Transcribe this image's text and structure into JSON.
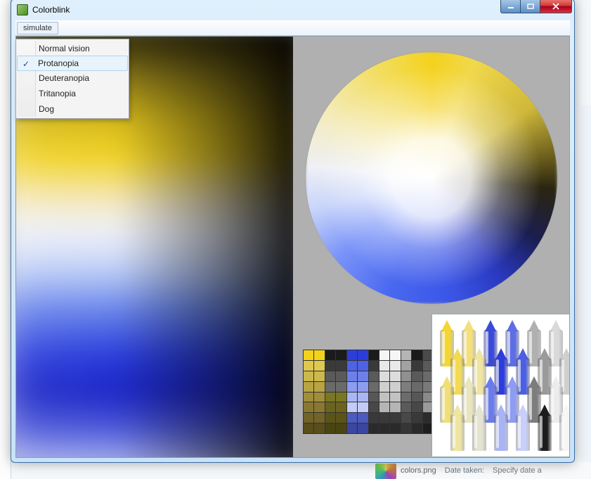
{
  "window": {
    "title": "Colorblink"
  },
  "menu": {
    "simulate_label": "simulate",
    "items": [
      "Normal vision",
      "Protanopia",
      "Deuteranopia",
      "Tritanopia",
      "Dog"
    ],
    "selected_index": 1
  },
  "palette_colors": [
    "#f2d21a",
    "#f2d21a",
    "#1b1b1b",
    "#1b1b1b",
    "#2b3edc",
    "#2b3edc",
    "#1b1b1b",
    "#f6f6f6",
    "#f6f6f6",
    "#b5b5b5",
    "#1b1b1b",
    "#4a4a4a",
    "#dec84f",
    "#dec84f",
    "#3a3a3a",
    "#3a3a3a",
    "#4d62e4",
    "#4d62e4",
    "#3a3a3a",
    "#e9e9e9",
    "#e9e9e9",
    "#a2a2a2",
    "#3a3a3a",
    "#5a5a5a",
    "#cdb84d",
    "#cdb84d",
    "#5a5a5a",
    "#5a5a5a",
    "#6d80ea",
    "#6d80ea",
    "#5a5a5a",
    "#dcdcdc",
    "#dcdcdc",
    "#909090",
    "#5a5a5a",
    "#6a6a6a",
    "#b9a444",
    "#b9a444",
    "#6a6a6a",
    "#6a6a6a",
    "#8c9cf0",
    "#8c9cf0",
    "#6a6a6a",
    "#cfcfcf",
    "#cfcfcf",
    "#7e7e7e",
    "#6a6a6a",
    "#7a7a7a",
    "#a18e3a",
    "#a18e3a",
    "#7a7624",
    "#7a7624",
    "#a9b6f5",
    "#a9b6f5",
    "#575757",
    "#c2c2c2",
    "#c2c2c2",
    "#6c6c6c",
    "#575757",
    "#8a8a8a",
    "#8a7830",
    "#8a7830",
    "#6a641e",
    "#6a641e",
    "#c3ccf8",
    "#c3ccf8",
    "#484848",
    "#b5b5b5",
    "#b5b5b5",
    "#5a5a5a",
    "#484848",
    "#9a9a9a",
    "#726326",
    "#726326",
    "#5a5418",
    "#5a5418",
    "#4c5bc0",
    "#4c5bc0",
    "#393939",
    "#3a3a3a",
    "#3a3a3a",
    "#484848",
    "#393939",
    "#2c2c2c",
    "#5a4d1c",
    "#5a4d1c",
    "#4a4412",
    "#4a4412",
    "#3a46a0",
    "#3a46a0",
    "#2a2a2a",
    "#2a2a2a",
    "#2a2a2a",
    "#363636",
    "#2a2a2a",
    "#1e1e1e"
  ],
  "crayons": [
    {
      "row": 0,
      "col": 0,
      "c": "#f4d632"
    },
    {
      "row": 0,
      "col": 1,
      "c": "#f4e07a"
    },
    {
      "row": 0,
      "col": 2,
      "c": "#3a4bd8"
    },
    {
      "row": 0,
      "col": 3,
      "c": "#5d6de6"
    },
    {
      "row": 0,
      "col": 4,
      "c": "#b0b0b0"
    },
    {
      "row": 0,
      "col": 5,
      "c": "#d9d9d9"
    },
    {
      "row": 1,
      "col": 0,
      "c": "#f2da54"
    },
    {
      "row": 1,
      "col": 1,
      "c": "#efe4a0"
    },
    {
      "row": 1,
      "col": 2,
      "c": "#2b3edc"
    },
    {
      "row": 1,
      "col": 3,
      "c": "#4a5fe2"
    },
    {
      "row": 1,
      "col": 4,
      "c": "#9a9a9a"
    },
    {
      "row": 1,
      "col": 5,
      "c": "#cfcfcf"
    },
    {
      "row": 2,
      "col": 0,
      "c": "#f0df78"
    },
    {
      "row": 2,
      "col": 1,
      "c": "#e9e5bc"
    },
    {
      "row": 2,
      "col": 2,
      "c": "#6a7cec"
    },
    {
      "row": 2,
      "col": 3,
      "c": "#8e9cf2"
    },
    {
      "row": 2,
      "col": 4,
      "c": "#7d7d7d"
    },
    {
      "row": 2,
      "col": 5,
      "c": "#ececec"
    },
    {
      "row": 3,
      "col": 0,
      "c": "#eee5a0"
    },
    {
      "row": 3,
      "col": 1,
      "c": "#e4e4d0"
    },
    {
      "row": 3,
      "col": 2,
      "c": "#a8b4f6"
    },
    {
      "row": 3,
      "col": 3,
      "c": "#c8cffa"
    },
    {
      "row": 3,
      "col": 4,
      "c": "#1d1d1d"
    },
    {
      "row": 3,
      "col": 5,
      "c": "#f6f6f6"
    }
  ],
  "backdrop": {
    "file_label": "colors.png",
    "meta_label": "Date taken:",
    "meta_value": "Specify date a"
  }
}
